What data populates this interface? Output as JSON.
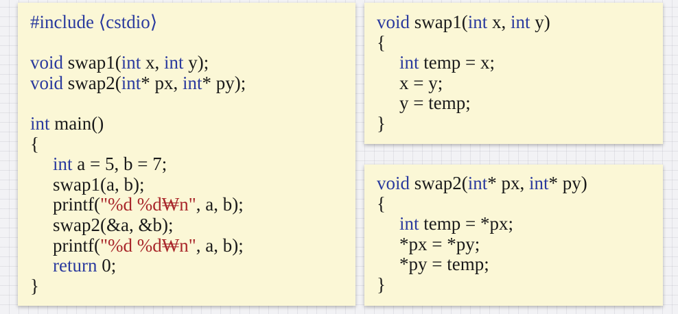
{
  "colors": {
    "background": "#f2f2f5",
    "panel": "#fbf7d6",
    "keyword": "#2a3a9e",
    "string": "#a8262a",
    "text": "#1a1a1a"
  },
  "main": {
    "include": "#include ⟨cstdio⟩",
    "decl_swap1": {
      "kw1": "void",
      "rest1": " swap1(",
      "kw2": "int",
      "rest2": " x, ",
      "kw3": "int",
      "rest3": " y);"
    },
    "decl_swap2": {
      "kw1": "void",
      "rest1": " swap2(",
      "kw2": "int",
      "rest2": "* px, ",
      "kw3": "int",
      "rest3": "* py);"
    },
    "main_sig": {
      "kw": "int",
      "rest": " main()"
    },
    "open_brace": "{",
    "line_ints": {
      "kw": "int",
      "rest": " a = 5, b = 7;"
    },
    "line_call_swap1": "swap1(a, b);",
    "line_printf1": {
      "pre": "printf(",
      "str": "\"%d %d₩n\"",
      "post": ", a, b);"
    },
    "line_call_swap2": "swap2(&a, &b);",
    "line_printf2": {
      "pre": "printf(",
      "str": "\"%d %d₩n\"",
      "post": ", a, b);"
    },
    "line_return": {
      "kw": "return",
      "rest": " 0;"
    },
    "close_brace": "}"
  },
  "swap1": {
    "sig": {
      "kw1": "void",
      "rest1": " swap1(",
      "kw2": "int",
      "rest2": " x, ",
      "kw3": "int",
      "rest3": " y)"
    },
    "open_brace": "{",
    "line_temp": {
      "kw": "int",
      "rest": " temp = x;"
    },
    "line_x": "x = y;",
    "line_y": "y = temp;",
    "close_brace": "}"
  },
  "swap2": {
    "sig": {
      "kw1": "void",
      "rest1": " swap2(",
      "kw2": "int",
      "rest2": "* px, ",
      "kw3": "int",
      "rest3": "* py)"
    },
    "open_brace": "{",
    "line_temp": {
      "kw": "int",
      "rest": " temp = *px;"
    },
    "line_px": "*px = *py;",
    "line_py": "*py = temp;",
    "close_brace": "}"
  }
}
